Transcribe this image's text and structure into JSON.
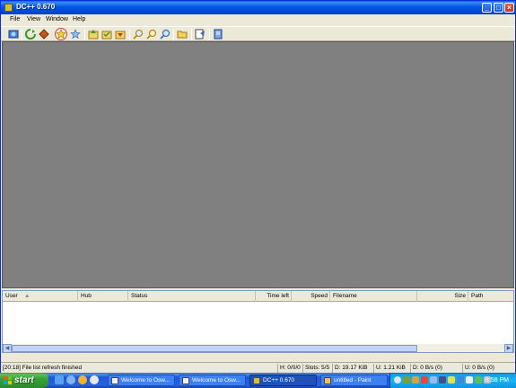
{
  "window": {
    "title": "DC++ 0.670"
  },
  "menu": {
    "items": [
      "File",
      "View",
      "Window",
      "Help"
    ]
  },
  "toolbar": {
    "buttons": [
      "public-hubs-icon",
      "reconnect-icon",
      "follow-redirect-icon",
      "favorite-hubs-icon",
      "favorite-users-icon",
      "download-queue-icon",
      "finished-downloads-icon",
      "upload-queue-icon",
      "search-icon",
      "search-spy-icon",
      "adl-search-icon",
      "open-file-list-icon",
      "settings-icon",
      "notepad-icon"
    ]
  },
  "transfers": {
    "columns": [
      "User",
      "Hub",
      "Status",
      "Time left",
      "Speed",
      "Filename",
      "Size",
      "Path"
    ]
  },
  "statusbar": {
    "message": "[20:18] File list refresh finished",
    "hubs": "H: 0/0/0",
    "slots": "Slots: 5/5",
    "downloaded": "D: 19.17 KiB",
    "uploaded": "U: 1.21 KiB",
    "download_speed": "D: 0 B/s (0)",
    "upload_speed": "U: 0 B/s (0)"
  },
  "taskbar": {
    "start_label": "start",
    "tasks": [
      {
        "label": "Welcome to Osw...",
        "active": false
      },
      {
        "label": "Welcome to Osw...",
        "active": false
      },
      {
        "label": "DC++ 0.670",
        "active": true
      },
      {
        "label": "untitled - Paint",
        "active": false
      }
    ],
    "clock": "8:58 PM"
  },
  "colors": {
    "titlebar": "#0055e5",
    "mdi_background": "#808080",
    "taskbar": "#2663e0",
    "start": "#36a336"
  }
}
